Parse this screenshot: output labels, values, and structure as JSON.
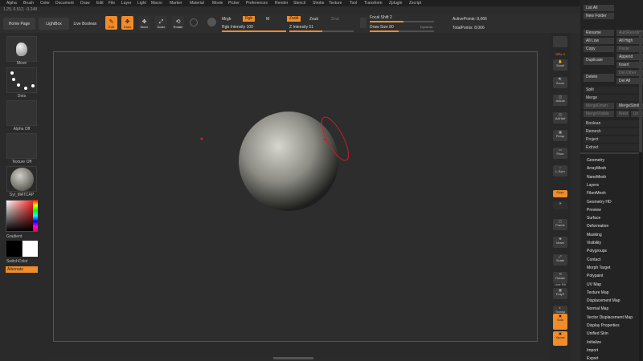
{
  "menu": [
    "Alpha",
    "Brush",
    "Color",
    "Document",
    "Draw",
    "Edit",
    "File",
    "Layer",
    "Light",
    "Macro",
    "Marker",
    "Material",
    "Movie",
    "Picker",
    "Preferences",
    "Render",
    "Stencil",
    "Stroke",
    "Texture",
    "Tool",
    "Transform",
    "Zplugin",
    "Zscript"
  ],
  "coords": "1.25, 0.512, -0.248",
  "toolbar": {
    "home": "Home Page",
    "lightbox": "LightBox",
    "live_boolean": "Live Boolean",
    "edit": "Edit",
    "draw": "Draw",
    "move": "Move",
    "scale": "Scale",
    "rotate": "Rotate",
    "mrgb": "Mrgb",
    "rgb": "Rgb",
    "m": "M",
    "rgb_intensity": "Rgb Intensity 100",
    "zadd": "Zadd",
    "zsub": "Zsub",
    "zcut": "Zcut",
    "z_intensity": "Z Intensity 51",
    "focal_shift": "Focal Shift 2",
    "draw_size": "Draw Size 80",
    "dynamic": "Dynamic",
    "active_points": "ActivePoints: 8,066",
    "total_points": "TotalPoints: 8,066",
    "rgb_intensity_pct": 100,
    "z_intensity_pct": 51,
    "focal_shift_pct": 52,
    "draw_size_pct": 45
  },
  "left": {
    "brush": "Move",
    "stroke": "Dots",
    "alpha": "Alpha Off",
    "texture": "Texture Off",
    "material": "Syl_MATCAP",
    "gradient": "Gradient",
    "switchcolor": "SwitchColor",
    "alternate": "Alternate"
  },
  "strip": {
    "spix": "SPix 3",
    "scroll": "Scroll",
    "zoom": "Zoom",
    "actual": "Actual",
    "aahalf": "AAHalf",
    "persp": "Persp",
    "floor": "Floor",
    "local": "L.Sym",
    "xyz": "Gxyz",
    "frame": "Frame",
    "move": "Move",
    "scale": "Scale",
    "rotate": "Rotate",
    "linefill": "Line Fill",
    "polyf": "PolyF",
    "transp": "Transp",
    "dynamic": "Dynamic",
    "solo": "Solo",
    "xpose": "Xpose"
  },
  "subtool": {
    "list_all": "List All",
    "new_folder": "New Folder",
    "rename": "Rename",
    "auto_reorder": "AutoReorder",
    "all_low": "All Low",
    "all_high": "All High",
    "copy": "Copy",
    "paste": "Paste",
    "append": "Append",
    "duplicate": "Duplicate",
    "insert": "Insert",
    "del_other": "Del Other",
    "delete": "Delete",
    "del_all": "Del All",
    "split": "Split",
    "merge": "Merge",
    "merge_down": "MergeDown",
    "merge_similar": "MergeSimilar",
    "merge_visible": "MergeVisible",
    "weld": "Weld",
    "uv": "Uv",
    "boolean": "Boolean",
    "remesh": "Remesh",
    "project": "Project",
    "extract": "Extract"
  },
  "tool_menu": [
    "Geometry",
    "ArrayMesh",
    "NanoMesh",
    "Layers",
    "FiberMesh",
    "Geometry HD",
    "Preview",
    "Surface",
    "Deformation",
    "Masking",
    "Visibility",
    "Polygroups",
    "Contact",
    "Morph Target",
    "Polypaint",
    "UV Map",
    "Texture Map",
    "Displacement Map",
    "Normal Map",
    "Vector Displacement Map",
    "Display Properties",
    "Unified Skin",
    "Initialize",
    "Import",
    "Export"
  ],
  "colors": {
    "accent": "#f08c2a",
    "bg": "#2b2b2b",
    "stroke_overlay": "#c8202a"
  }
}
